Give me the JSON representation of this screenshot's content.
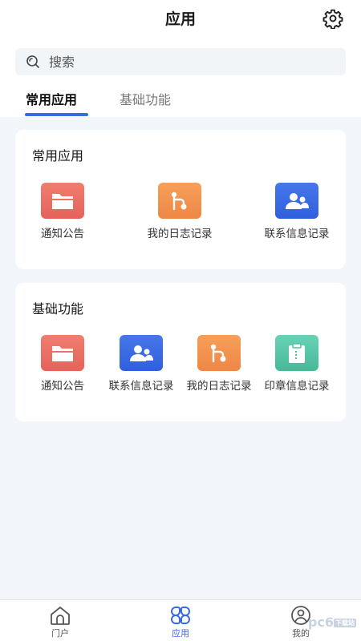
{
  "header": {
    "title": "应用",
    "settings_icon": "gear-icon"
  },
  "search": {
    "placeholder": "搜索",
    "value": "",
    "icon": "search-icon"
  },
  "tabs": [
    {
      "label": "常用应用",
      "active": true
    },
    {
      "label": "基础功能",
      "active": false
    }
  ],
  "sections": [
    {
      "title": "常用应用",
      "apps": [
        {
          "label": "通知公告",
          "icon": "folder-icon",
          "color": "#e8695f"
        },
        {
          "label": "我的日志记录",
          "icon": "log-icon",
          "color": "#f28e4b"
        },
        {
          "label": "联系信息记录",
          "icon": "contacts-icon",
          "color": "#3465df"
        }
      ]
    },
    {
      "title": "基础功能",
      "apps": [
        {
          "label": "通知公告",
          "icon": "folder-icon",
          "color": "#e8695f"
        },
        {
          "label": "联系信息记录",
          "icon": "contacts-icon",
          "color": "#3465df"
        },
        {
          "label": "我的日志记录",
          "icon": "log-icon",
          "color": "#f28e4b"
        },
        {
          "label": "印章信息记录",
          "icon": "clipboard-icon",
          "color": "#52c2a2"
        }
      ]
    }
  ],
  "bottom_nav": [
    {
      "label": "门户",
      "icon": "home-icon",
      "active": false
    },
    {
      "label": "应用",
      "icon": "apps-icon",
      "active": true
    },
    {
      "label": "我的",
      "icon": "user-icon",
      "active": false
    }
  ],
  "watermark": {
    "text": "pc6",
    "badge": "下载站"
  },
  "colors": {
    "accent": "#3a6ae0",
    "background": "#f2f5f9"
  }
}
